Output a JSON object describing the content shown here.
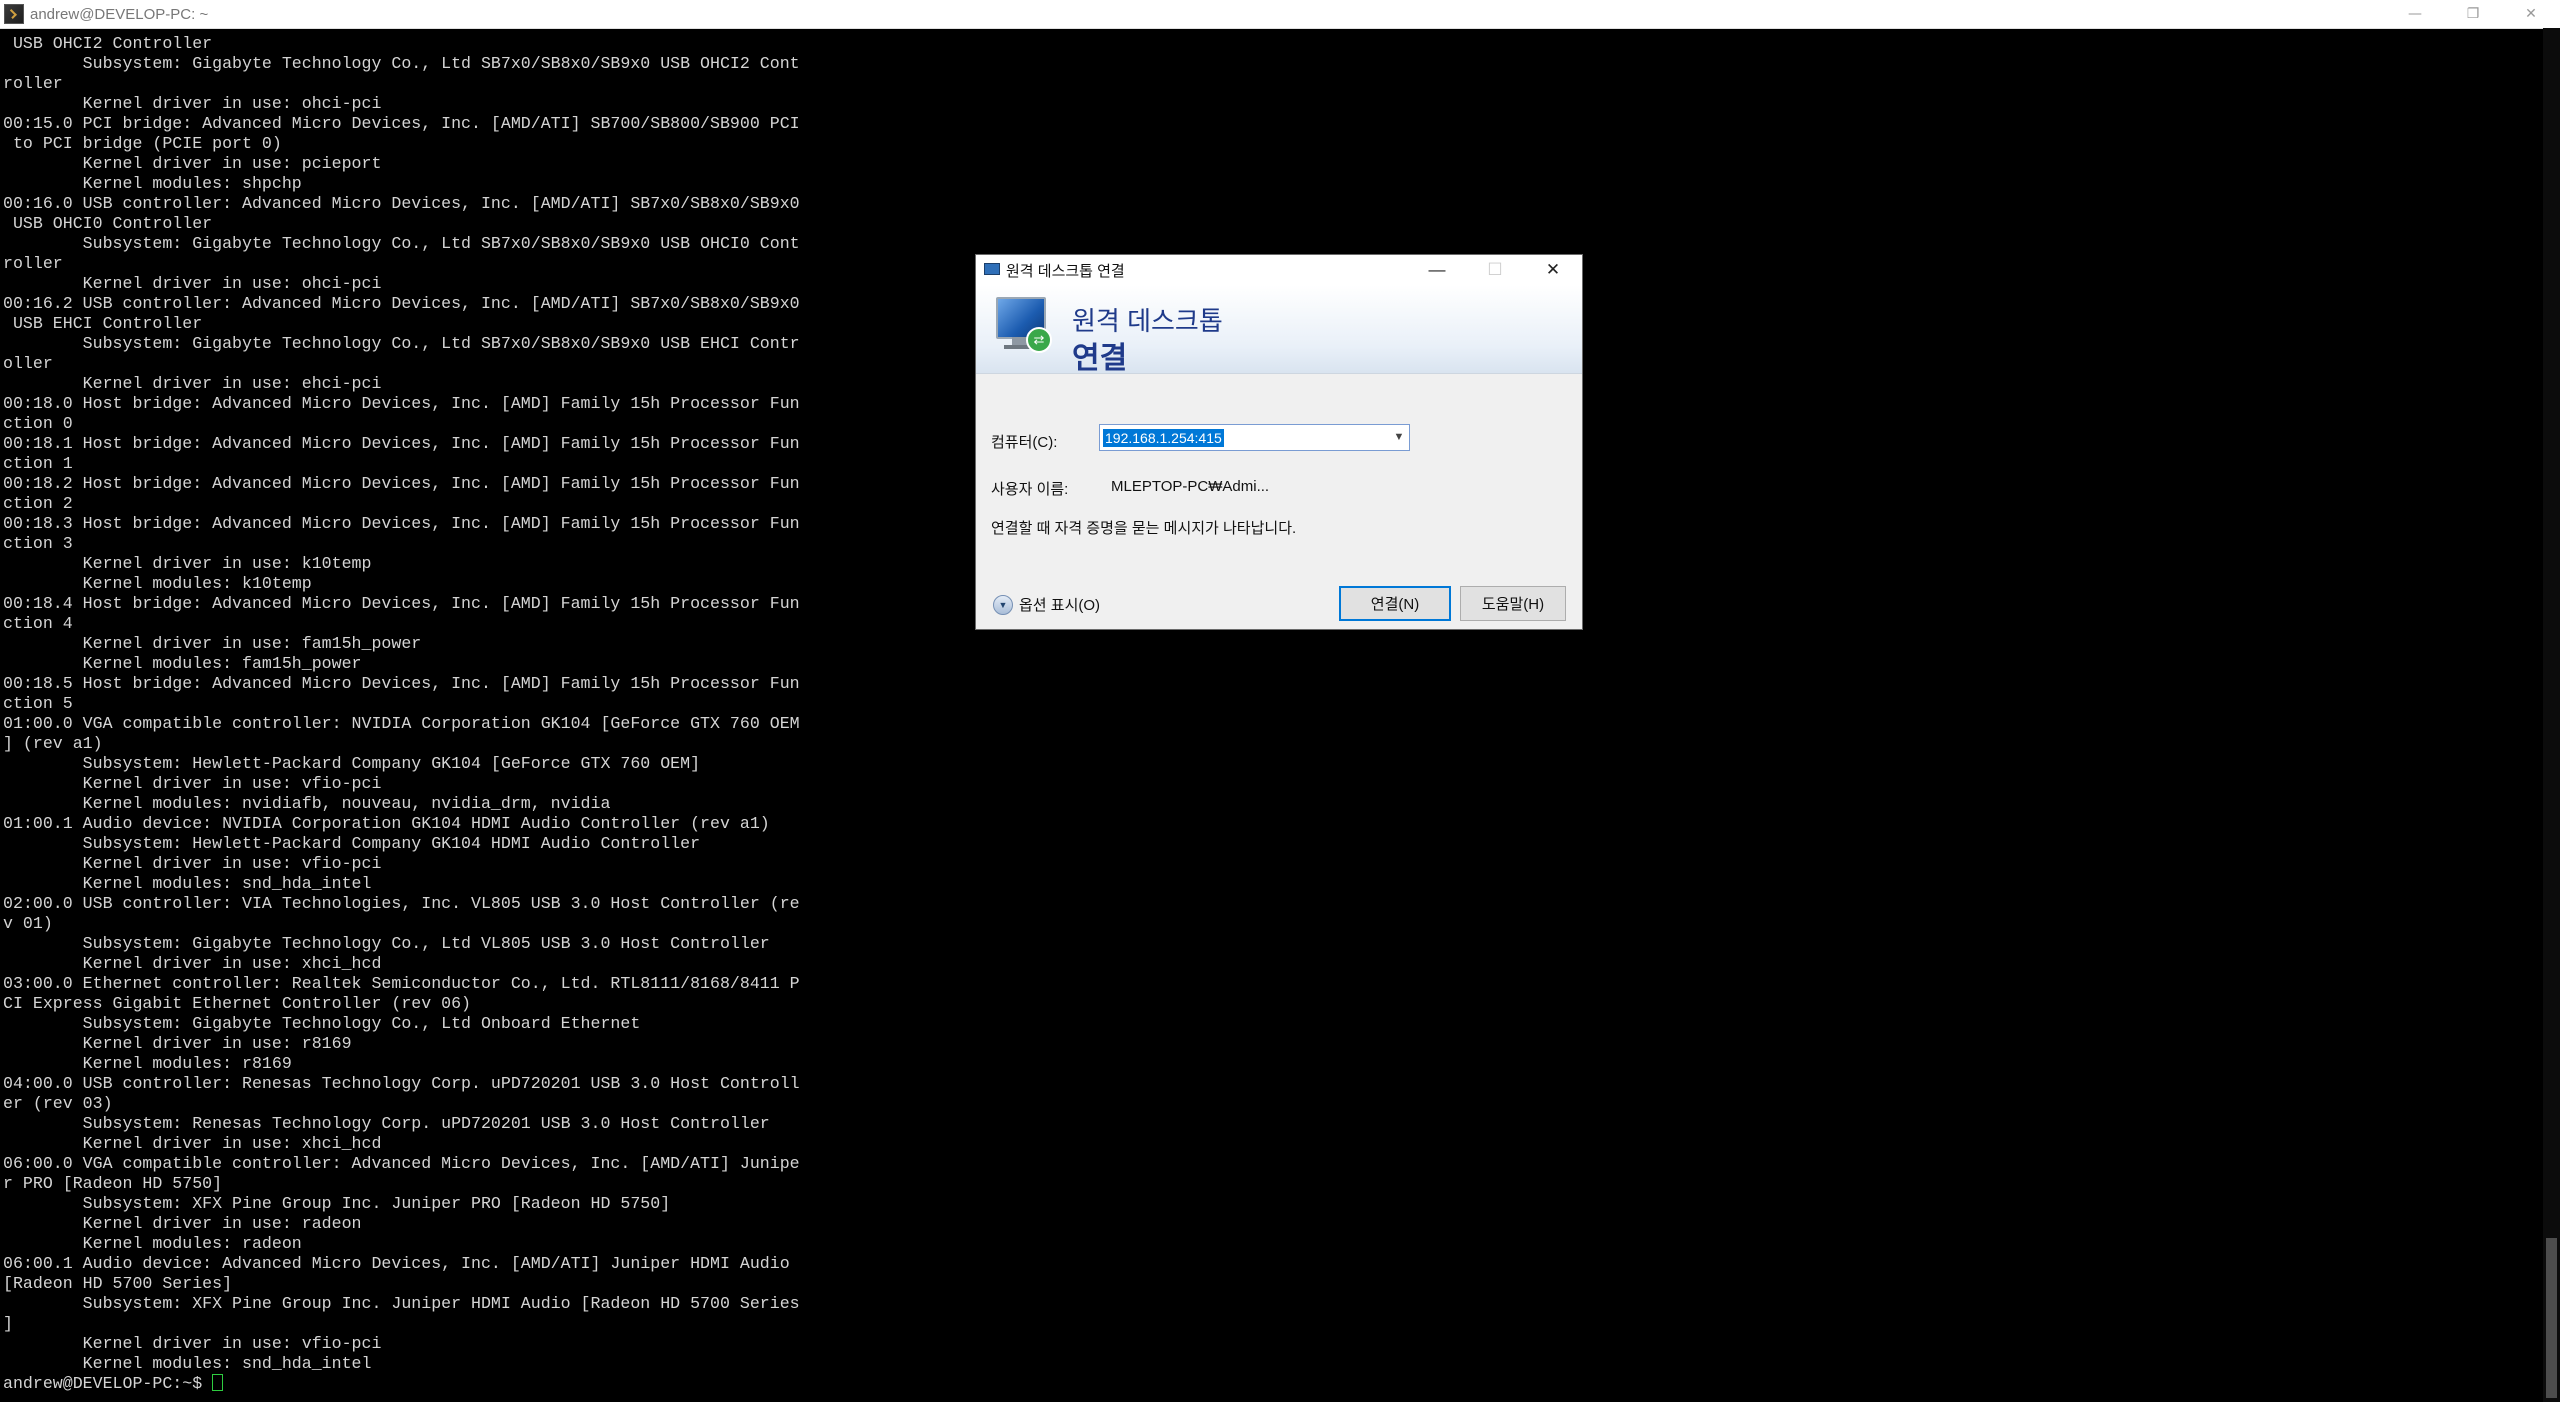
{
  "terminal_window": {
    "title": "andrew@DEVELOP-PC: ~",
    "controls": {
      "minimize": "—",
      "maximize": "❐",
      "close": "✕"
    }
  },
  "terminal": {
    "lines": [
      " USB OHCI2 Controller",
      "        Subsystem: Gigabyte Technology Co., Ltd SB7x0/SB8x0/SB9x0 USB OHCI2 Cont",
      "roller",
      "        Kernel driver in use: ohci-pci",
      "00:15.0 PCI bridge: Advanced Micro Devices, Inc. [AMD/ATI] SB700/SB800/SB900 PCI",
      " to PCI bridge (PCIE port 0)",
      "        Kernel driver in use: pcieport",
      "        Kernel modules: shpchp",
      "00:16.0 USB controller: Advanced Micro Devices, Inc. [AMD/ATI] SB7x0/SB8x0/SB9x0",
      " USB OHCI0 Controller",
      "        Subsystem: Gigabyte Technology Co., Ltd SB7x0/SB8x0/SB9x0 USB OHCI0 Cont",
      "roller",
      "        Kernel driver in use: ohci-pci",
      "00:16.2 USB controller: Advanced Micro Devices, Inc. [AMD/ATI] SB7x0/SB8x0/SB9x0",
      " USB EHCI Controller",
      "        Subsystem: Gigabyte Technology Co., Ltd SB7x0/SB8x0/SB9x0 USB EHCI Contr",
      "oller",
      "        Kernel driver in use: ehci-pci",
      "00:18.0 Host bridge: Advanced Micro Devices, Inc. [AMD] Family 15h Processor Fun",
      "ction 0",
      "00:18.1 Host bridge: Advanced Micro Devices, Inc. [AMD] Family 15h Processor Fun",
      "ction 1",
      "00:18.2 Host bridge: Advanced Micro Devices, Inc. [AMD] Family 15h Processor Fun",
      "ction 2",
      "00:18.3 Host bridge: Advanced Micro Devices, Inc. [AMD] Family 15h Processor Fun",
      "ction 3",
      "        Kernel driver in use: k10temp",
      "        Kernel modules: k10temp",
      "00:18.4 Host bridge: Advanced Micro Devices, Inc. [AMD] Family 15h Processor Fun",
      "ction 4",
      "        Kernel driver in use: fam15h_power",
      "        Kernel modules: fam15h_power",
      "00:18.5 Host bridge: Advanced Micro Devices, Inc. [AMD] Family 15h Processor Fun",
      "ction 5",
      "01:00.0 VGA compatible controller: NVIDIA Corporation GK104 [GeForce GTX 760 OEM",
      "] (rev a1)",
      "        Subsystem: Hewlett-Packard Company GK104 [GeForce GTX 760 OEM]",
      "        Kernel driver in use: vfio-pci",
      "        Kernel modules: nvidiafb, nouveau, nvidia_drm, nvidia",
      "01:00.1 Audio device: NVIDIA Corporation GK104 HDMI Audio Controller (rev a1)",
      "        Subsystem: Hewlett-Packard Company GK104 HDMI Audio Controller",
      "        Kernel driver in use: vfio-pci",
      "        Kernel modules: snd_hda_intel",
      "02:00.0 USB controller: VIA Technologies, Inc. VL805 USB 3.0 Host Controller (re",
      "v 01)",
      "        Subsystem: Gigabyte Technology Co., Ltd VL805 USB 3.0 Host Controller",
      "        Kernel driver in use: xhci_hcd",
      "03:00.0 Ethernet controller: Realtek Semiconductor Co., Ltd. RTL8111/8168/8411 P",
      "CI Express Gigabit Ethernet Controller (rev 06)",
      "        Subsystem: Gigabyte Technology Co., Ltd Onboard Ethernet",
      "        Kernel driver in use: r8169",
      "        Kernel modules: r8169",
      "04:00.0 USB controller: Renesas Technology Corp. uPD720201 USB 3.0 Host Controll",
      "er (rev 03)",
      "        Subsystem: Renesas Technology Corp. uPD720201 USB 3.0 Host Controller",
      "        Kernel driver in use: xhci_hcd",
      "06:00.0 VGA compatible controller: Advanced Micro Devices, Inc. [AMD/ATI] Junipe",
      "r PRO [Radeon HD 5750]",
      "        Subsystem: XFX Pine Group Inc. Juniper PRO [Radeon HD 5750]",
      "        Kernel driver in use: radeon",
      "        Kernel modules: radeon",
      "06:00.1 Audio device: Advanced Micro Devices, Inc. [AMD/ATI] Juniper HDMI Audio",
      "[Radeon HD 5700 Series]",
      "        Subsystem: XFX Pine Group Inc. Juniper HDMI Audio [Radeon HD 5700 Series",
      "]",
      "        Kernel driver in use: vfio-pci",
      "        Kernel modules: snd_hda_intel"
    ],
    "prompt": "andrew@DEVELOP-PC:~$ "
  },
  "dialog": {
    "title": "원격 데스크톱 연결",
    "controls": {
      "minimize": "—",
      "maximize": "☐",
      "close": "✕"
    },
    "banner_line1": "원격 데스크톱",
    "banner_line2": "연결",
    "computer_label": "컴퓨터(C):",
    "computer_value": "192.168.1.254:415",
    "username_label": "사용자 이름:",
    "username_value": "MLEPTOP-PC₩Admi...",
    "note": "연결할 때 자격 증명을 묻는 메시지가 나타납니다.",
    "options_label": "옵션 표시(O)",
    "connect_button": "연결(N)",
    "help_button": "도움말(H)"
  },
  "colors": {
    "terminal_bg": "#000000",
    "terminal_fg": "#d4d4d4",
    "dialog_heading": "#1f3a8a",
    "selection": "#0078d7",
    "cursor": "#2ecc40"
  }
}
